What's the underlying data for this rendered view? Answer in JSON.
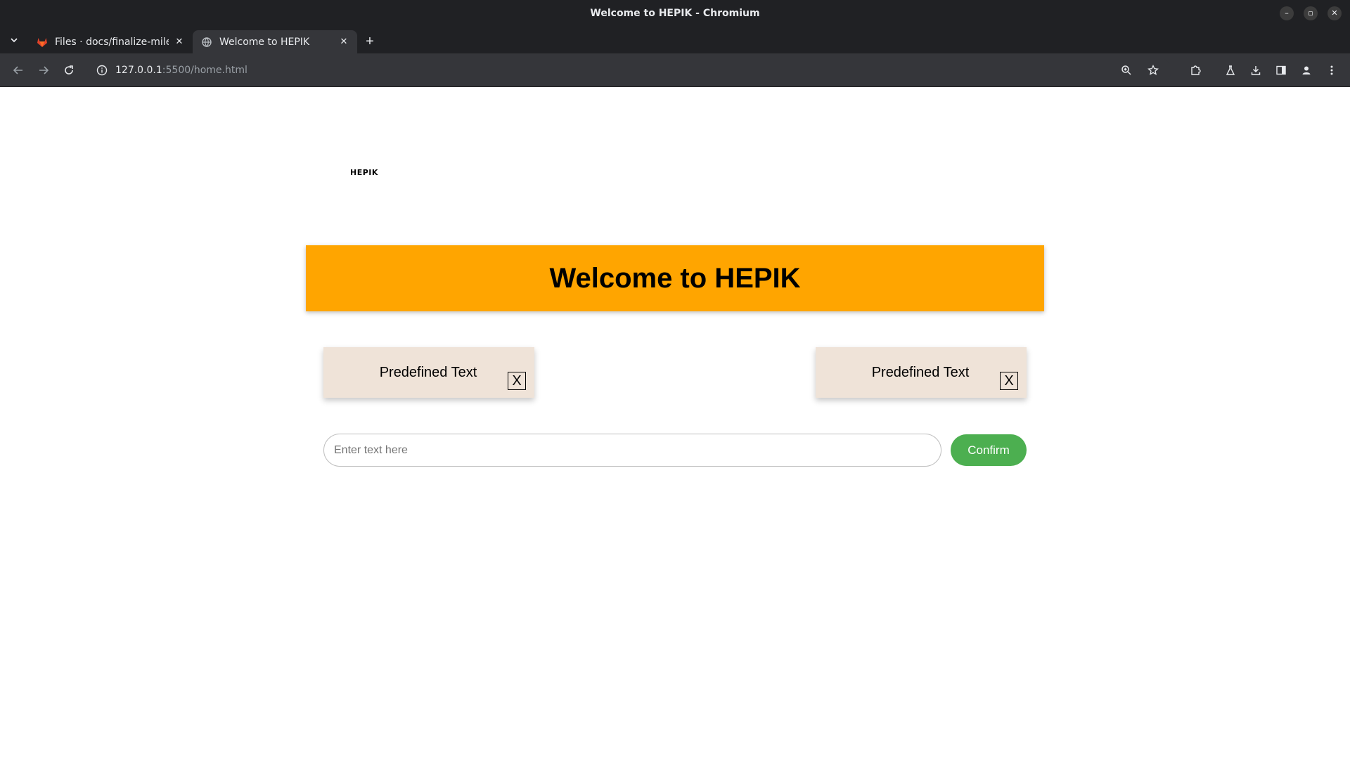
{
  "window": {
    "title": "Welcome to HEPIK - Chromium",
    "controls": {
      "minimize": "–",
      "restore": "▫",
      "close": "✕"
    }
  },
  "tabs": [
    {
      "title": "Files · docs/finalize-mile",
      "favicon": "gitlab-icon",
      "active": false
    },
    {
      "title": "Welcome to HEPIK",
      "favicon": "globe-icon",
      "active": true
    }
  ],
  "toolbar": {
    "url_host": "127.0.0.1",
    "url_rest": ":5500/home.html"
  },
  "page": {
    "brand": "HEPIK",
    "banner_title": "Welcome to HEPIK",
    "cards": [
      {
        "text": "Predefined Text",
        "close_label": "X"
      },
      {
        "text": "Predefined Text",
        "close_label": "X"
      }
    ],
    "input": {
      "placeholder": "Enter text here",
      "value": ""
    },
    "confirm_label": "Confirm"
  },
  "colors": {
    "banner": "#ffa500",
    "card": "#efe3d8",
    "confirm": "#4caf50"
  }
}
